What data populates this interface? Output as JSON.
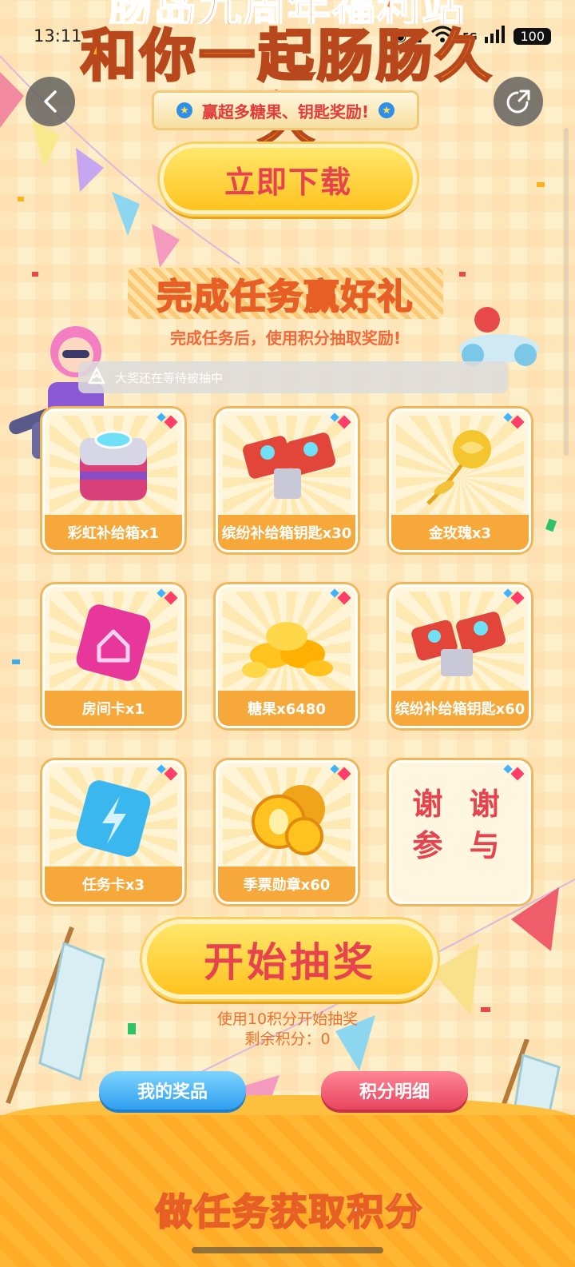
{
  "status_bar": {
    "time": "13:11",
    "network": "5G",
    "battery": "100"
  },
  "header": {
    "title_line1": "肠岛九周年福利站",
    "title_line2": "和你一起肠肠久久",
    "subtitle": "赢超多糖果、钥匙奖励!"
  },
  "download_button": "立即下载",
  "task_section": {
    "heading": "完成任务赢好礼",
    "subheading": "完成任务后，使用积分抽取奖励!"
  },
  "marquee": {
    "text": "大奖还在等待被抽中",
    "icon": "trophy-icon"
  },
  "prizes": [
    {
      "label": "彩虹补给箱x1",
      "icon": "supply-box-icon"
    },
    {
      "label": "缤纷补给箱钥匙x30",
      "icon": "key-icon"
    },
    {
      "label": "金玫瑰x3",
      "icon": "gold-rose-icon"
    },
    {
      "label": "房间卡x1",
      "icon": "room-card-icon"
    },
    {
      "label": "糖果x6480",
      "icon": "candy-icon"
    },
    {
      "label": "缤纷补给箱钥匙x60",
      "icon": "key-icon"
    },
    {
      "label": "任务卡x3",
      "icon": "task-card-icon"
    },
    {
      "label": "季票勋章x60",
      "icon": "medal-icon"
    },
    {
      "label": "谢谢参与",
      "line1": "谢 谢",
      "line2": "参 与",
      "icon": "none"
    }
  ],
  "draw": {
    "button": "开始抽奖",
    "cost": "使用10积分开始抽奖",
    "remaining": "剩余积分：0"
  },
  "buttons": {
    "my_prizes": "我的奖品",
    "points_detail": "积分明细"
  },
  "footer_heading": "做任务获取积分",
  "colors": {
    "accent_red": "#e6434f",
    "gold": "#ffc21f",
    "orange": "#f6a93a",
    "blue": "#2f9ff0"
  }
}
